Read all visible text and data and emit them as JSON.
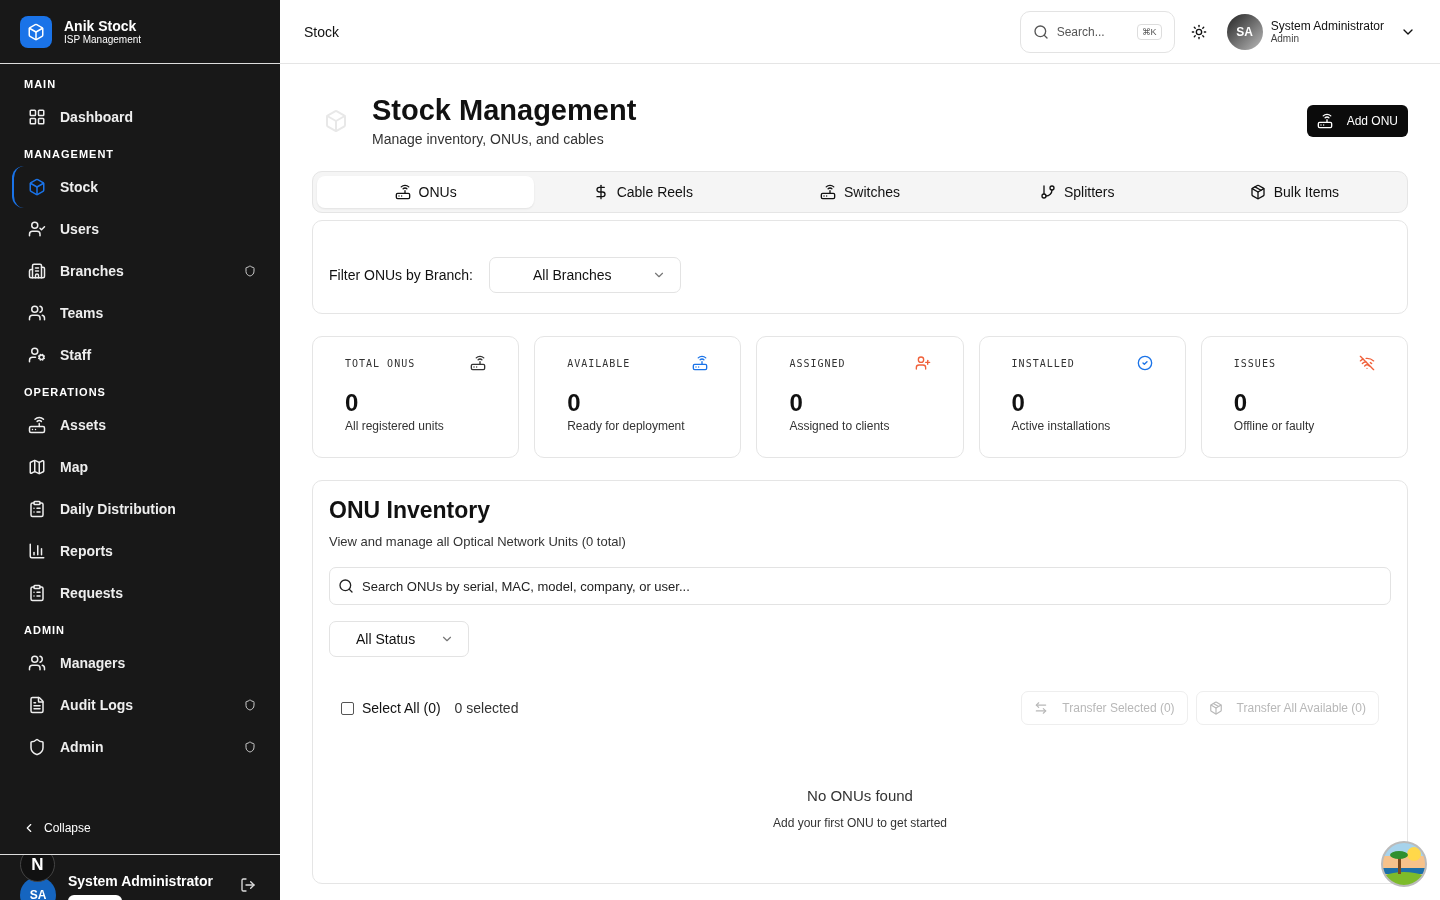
{
  "brand": {
    "name": "Anik Stock",
    "subtitle": "ISP Management"
  },
  "sidebar": {
    "sections": [
      {
        "title": "MAIN",
        "items": [
          {
            "label": "Dashboard",
            "selected": false,
            "protected": false
          }
        ]
      },
      {
        "title": "MANAGEMENT",
        "items": [
          {
            "label": "Stock",
            "selected": true,
            "protected": false
          },
          {
            "label": "Users",
            "selected": false,
            "protected": false
          },
          {
            "label": "Branches",
            "selected": false,
            "protected": true
          },
          {
            "label": "Teams",
            "selected": false,
            "protected": false
          },
          {
            "label": "Staff",
            "selected": false,
            "protected": false
          }
        ]
      },
      {
        "title": "OPERATIONS",
        "items": [
          {
            "label": "Assets",
            "selected": false,
            "protected": false
          },
          {
            "label": "Map",
            "selected": false,
            "protected": false
          },
          {
            "label": "Daily Distribution",
            "selected": false,
            "protected": false
          },
          {
            "label": "Reports",
            "selected": false,
            "protected": false
          },
          {
            "label": "Requests",
            "selected": false,
            "protected": false
          }
        ]
      },
      {
        "title": "ADMIN",
        "items": [
          {
            "label": "Managers",
            "selected": false,
            "protected": false
          },
          {
            "label": "Audit Logs",
            "selected": false,
            "protected": true
          },
          {
            "label": "Admin",
            "selected": false,
            "protected": true
          }
        ]
      }
    ],
    "collapse": "Collapse",
    "user": {
      "initials": "SA",
      "name": "System Administrator"
    },
    "dev_badge": "N"
  },
  "header": {
    "breadcrumb": "Stock",
    "search": {
      "placeholder": "Search...",
      "shortcut": "⌘K"
    },
    "user": {
      "initials": "SA",
      "name": "System Administrator",
      "role": "Admin"
    }
  },
  "page": {
    "title": "Stock Management",
    "subtitle": "Manage inventory, ONUs, and cables",
    "action": "Add ONU"
  },
  "tabs": [
    {
      "label": "ONUs",
      "selected": true
    },
    {
      "label": "Cable Reels",
      "selected": false
    },
    {
      "label": "Switches",
      "selected": false
    },
    {
      "label": "Splitters",
      "selected": false
    },
    {
      "label": "Bulk Items",
      "selected": false
    }
  ],
  "filter": {
    "label": "Filter ONUs by Branch:",
    "value": "All Branches"
  },
  "stats": [
    {
      "label": "TOTAL ONUS",
      "value": "0",
      "caption": "All registered units",
      "color": "#333333"
    },
    {
      "label": "AVAILABLE",
      "value": "0",
      "caption": "Ready for deployment",
      "color": "#1a73e8"
    },
    {
      "label": "ASSIGNED",
      "value": "0",
      "caption": "Assigned to clients",
      "color": "#f0603a"
    },
    {
      "label": "INSTALLED",
      "value": "0",
      "caption": "Active installations",
      "color": "#1a73e8"
    },
    {
      "label": "ISSUES",
      "value": "0",
      "caption": "Offline or faulty",
      "color": "#f0603a"
    }
  ],
  "inventory": {
    "title": "ONU Inventory",
    "subtitle": "View and manage all Optical Network Units (0 total)",
    "search": {
      "placeholder": "Search ONUs by serial, MAC, model, company, or user..."
    },
    "status_filter": "All Status",
    "select_all": {
      "label": "Select All (0)",
      "checked": false
    },
    "selected_count": "0 selected",
    "actions": [
      {
        "label": "Transfer Selected (0)",
        "disabled": true
      },
      {
        "label": "Transfer All Available (0)",
        "disabled": true
      }
    ],
    "empty": {
      "title": "No ONUs found",
      "hint": "Add your first ONU to get started"
    }
  }
}
